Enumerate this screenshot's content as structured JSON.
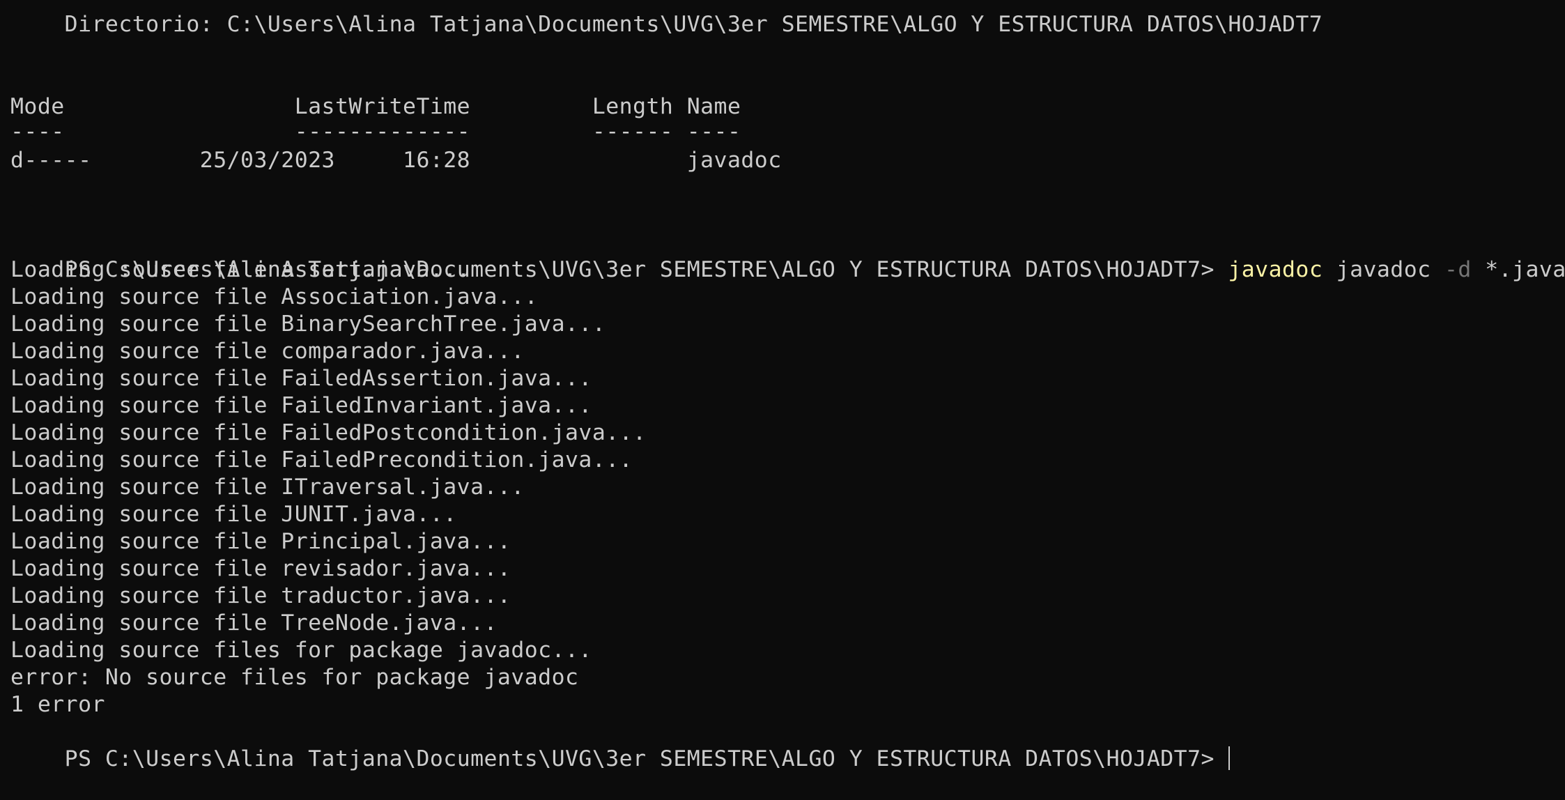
{
  "colors": {
    "background": "#0c0c0c",
    "foreground": "#cccccc",
    "command": "#f9f1a5",
    "parameter": "#767676"
  },
  "listing": {
    "directory_line": "    Directorio: C:\\Users\\Alina Tatjana\\Documents\\UVG\\3er SEMESTRE\\ALGO Y ESTRUCTURA DATOS\\HOJADT7",
    "header": "Mode                 LastWriteTime         Length Name",
    "underline": "----                 -------------         ------ ----",
    "entry": "d-----        25/03/2023     16:28                javadoc"
  },
  "command_line": {
    "prompt": "PS C:\\Users\\Alina Tatjana\\Documents\\UVG\\3er SEMESTRE\\ALGO Y ESTRUCTURA DATOS\\HOJADT7> ",
    "command": "javadoc",
    "arg1": " javadoc ",
    "flag": "-d",
    "arg2": " *.java"
  },
  "output": [
    "Loading source file Assert.java...",
    "Loading source file Association.java...",
    "Loading source file BinarySearchTree.java...",
    "Loading source file comparador.java...",
    "Loading source file FailedAssertion.java...",
    "Loading source file FailedInvariant.java...",
    "Loading source file FailedPostcondition.java...",
    "Loading source file FailedPrecondition.java...",
    "Loading source file ITraversal.java...",
    "Loading source file JUNIT.java...",
    "Loading source file Principal.java...",
    "Loading source file revisador.java...",
    "Loading source file traductor.java...",
    "Loading source file TreeNode.java...",
    "Loading source files for package javadoc...",
    "error: No source files for package javadoc",
    "1 error"
  ],
  "final_prompt": "PS C:\\Users\\Alina Tatjana\\Documents\\UVG\\3er SEMESTRE\\ALGO Y ESTRUCTURA DATOS\\HOJADT7>"
}
